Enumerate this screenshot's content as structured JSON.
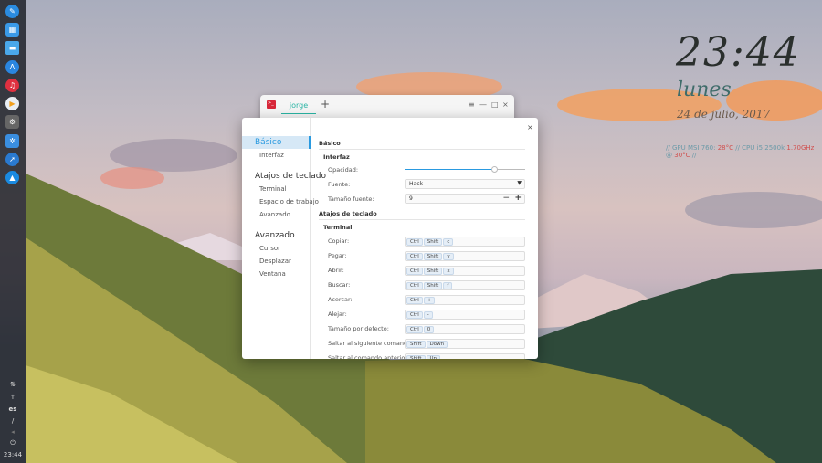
{
  "desktop": {
    "clock": "23:44",
    "day": "lunes",
    "date": "24 de julio, 2017",
    "sysinfo": {
      "sep": "//",
      "gpu_label": "GPU MSI 760:",
      "gpu_temp": "28°C",
      "cpu_label": "CPU i5 2500k",
      "cpu_freq": "1.70GHz",
      "at": "@",
      "cpu_temp": "30°C"
    }
  },
  "dock": {
    "icons": [
      "launcher-icon",
      "multitask-icon",
      "file-manager-icon",
      "app-store-icon",
      "music-icon",
      "video-player-icon",
      "settings-icon",
      "control-center-icon",
      "browser-icon",
      "deepin-icon"
    ],
    "tray": {
      "lang": "es",
      "time": "23:44"
    }
  },
  "terminal": {
    "tab": "jorge",
    "add": "+",
    "menu": "≡",
    "minimize": "—",
    "maximize": "□",
    "close": "×"
  },
  "settings": {
    "close": "×",
    "sidebar": [
      {
        "label": "Básico",
        "level": 1,
        "active": true
      },
      {
        "label": "Interfaz",
        "level": 2
      },
      {
        "label": "Atajos de teclado",
        "level": 1
      },
      {
        "label": "Terminal",
        "level": 2
      },
      {
        "label": "Espacio de trabajo",
        "level": 2
      },
      {
        "label": "Avanzado",
        "level": 2
      },
      {
        "label": "Avanzado",
        "level": 1
      },
      {
        "label": "Cursor",
        "level": 2
      },
      {
        "label": "Desplazar",
        "level": 2
      },
      {
        "label": "Ventana",
        "level": 2
      }
    ],
    "basic_heading": "Básico",
    "interface_heading": "Interfaz",
    "opacity_label": "Opacidad:",
    "opacity_value": 0.75,
    "font_label": "Fuente:",
    "font_value": "Hack",
    "size_label": "Tamaño fuente:",
    "size_value": "9",
    "minus": "−",
    "plus": "+",
    "shortcuts_heading": "Atajos de teclado",
    "terminal_heading": "Terminal",
    "shortcuts": [
      {
        "label": "Copiar:",
        "keys": [
          "Ctrl",
          "Shift",
          "c"
        ]
      },
      {
        "label": "Pegar:",
        "keys": [
          "Ctrl",
          "Shift",
          "v"
        ]
      },
      {
        "label": "Abrir:",
        "keys": [
          "Ctrl",
          "Shift",
          "x"
        ]
      },
      {
        "label": "Buscar:",
        "keys": [
          "Ctrl",
          "Shift",
          "f"
        ]
      },
      {
        "label": "Acercar:",
        "keys": [
          "Ctrl",
          "+"
        ]
      },
      {
        "label": "Alejar:",
        "keys": [
          "Ctrl",
          "-"
        ]
      },
      {
        "label": "Tamaño por defecto:",
        "keys": [
          "Ctrl",
          "0"
        ]
      },
      {
        "label": "Saltar al siguiente comando:",
        "keys": [
          "Shift",
          "Down"
        ]
      },
      {
        "label": "Saltar al comando anterior:",
        "keys": [
          "Shift",
          "Up"
        ]
      }
    ]
  },
  "colors": {
    "accent": "#2a9ae0",
    "terminal_accent": "#2ab5a5"
  }
}
